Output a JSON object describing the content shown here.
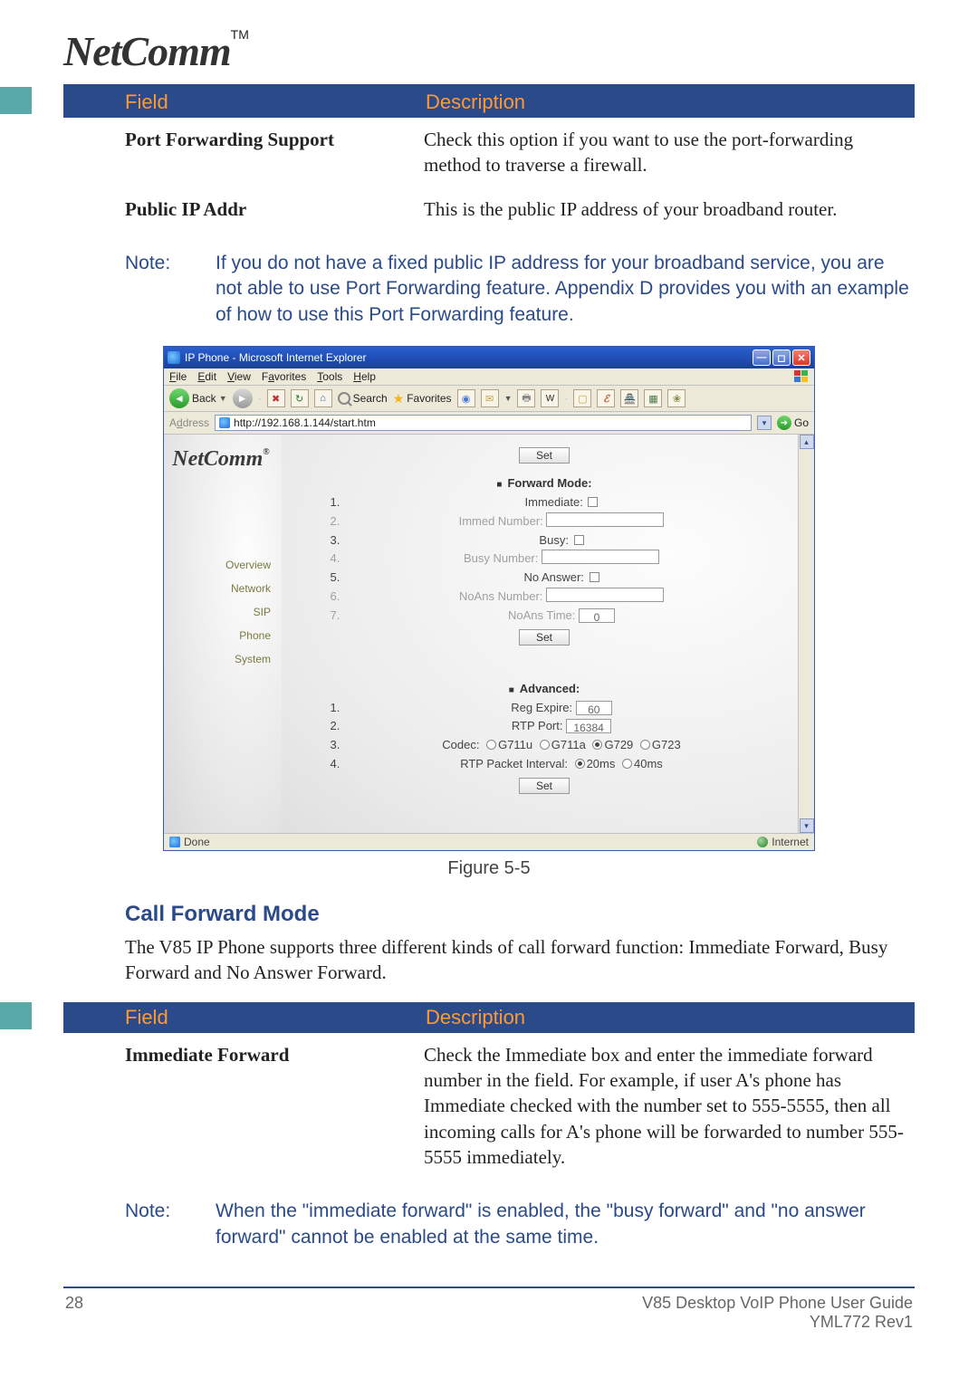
{
  "header": {
    "logo_text": "NetComm",
    "logo_tm": "TM"
  },
  "table1": {
    "head_field": "Field",
    "head_desc": "Description",
    "rows": [
      {
        "field": "Port Forwarding Support",
        "desc": "Check this option if you want to use the port-forwarding method to traverse a firewall."
      },
      {
        "field": "Public IP Addr",
        "desc": "This is the public IP address of your broadband router."
      }
    ]
  },
  "note1": {
    "label": "Note:",
    "text": "If you do not have a fixed public IP address for your broadband service, you are not able to use Port Forwarding feature.  Appendix D provides you with an example of how to use this Port Forwarding feature."
  },
  "browser": {
    "title": "IP Phone - Microsoft Internet Explorer",
    "menu": [
      "File",
      "Edit",
      "View",
      "Favorites",
      "Tools",
      "Help"
    ],
    "tool_back": "Back",
    "tool_search": "Search",
    "tool_fav": "Favorites",
    "addr_label": "Address",
    "addr_value": "http://192.168.1.144/start.htm",
    "go_label": "Go",
    "sidebar_logo": "NetComm",
    "sidebar_logo_reg": "®",
    "sidebar_items": [
      "Overview",
      "Network",
      "SIP",
      "Phone",
      "System"
    ],
    "set_btn": "Set",
    "sec_forward": "Forward Mode:",
    "fwd_items": {
      "immediate": "Immediate:",
      "immed_num": "Immed Number:",
      "busy": "Busy:",
      "busy_num": "Busy Number:",
      "no_answer": "No Answer:",
      "noans_num": "NoAns Number:",
      "noans_time": "NoAns Time:",
      "noans_time_val": "0"
    },
    "sec_advanced": "Advanced:",
    "adv_items": {
      "reg_expire": "Reg Expire:",
      "reg_expire_val": "60",
      "rtp_port": "RTP Port:",
      "rtp_port_val": "16384",
      "codec": "Codec:",
      "codec_opts": [
        "G711u",
        "G711a",
        "G729",
        "G723"
      ],
      "codec_selected": "G729",
      "rtp_interval": "RTP Packet Interval:",
      "rtp_interval_opts": [
        "20ms",
        "40ms"
      ],
      "rtp_interval_selected": "20ms"
    },
    "status_done": "Done",
    "status_zone": "Internet"
  },
  "figure_caption": "Figure 5-5",
  "section2": {
    "heading": "Call Forward Mode",
    "para": "The V85 IP Phone supports three different kinds of call forward function: Immediate Forward, Busy Forward and No Answer Forward."
  },
  "table2": {
    "head_field": "Field",
    "head_desc": "Description",
    "rows": [
      {
        "field": "Immediate Forward",
        "desc": "Check the Immediate box and enter the immediate forward number in the field. For example, if user A's phone has Immediate checked with the number set to 555-5555, then all incoming calls for A's phone will be forwarded to number 555-5555 immediately."
      }
    ]
  },
  "note2": {
    "label": "Note:",
    "text": "When the \"immediate forward\" is enabled, the \"busy forward\" and \"no answer forward\" cannot be enabled at the same time."
  },
  "footer": {
    "page": "28",
    "right1": "V85 Desktop VoIP Phone User Guide",
    "right2": "YML772 Rev1"
  }
}
